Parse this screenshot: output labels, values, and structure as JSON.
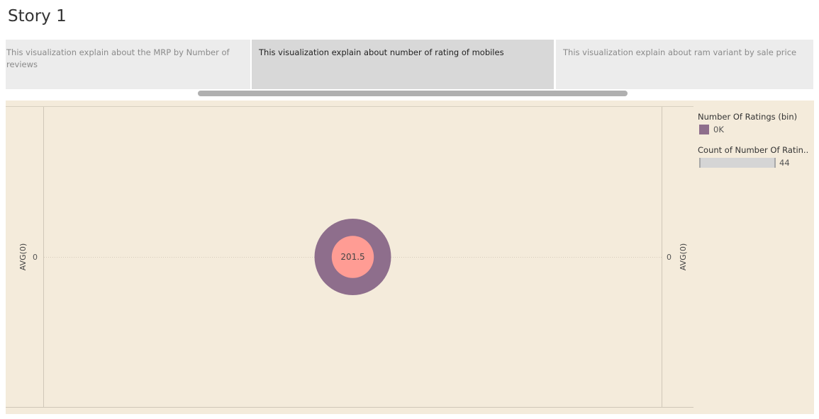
{
  "story": {
    "title": "Story 1"
  },
  "tabs": [
    {
      "label": "This visualization explain about the MRP by Number of reviews",
      "active": false
    },
    {
      "label": "This visualization explain about number of rating of mobiles",
      "active": true
    },
    {
      "label": "This visualization explain about ram variant by sale price",
      "active": false
    }
  ],
  "legend": {
    "color_title": "Number Of Ratings (bin)",
    "color_entries": [
      {
        "label": "0K",
        "color": "#8e6e8c"
      }
    ],
    "size_title": "Count of Number Of Ratin..",
    "size_max_label": "44"
  },
  "chart_data": {
    "type": "scatter",
    "title": "",
    "ylabel_left": "AVG(0)",
    "ylabel_right": "AVG(0)",
    "y_tick_left": "0",
    "y_tick_right": "0",
    "grid": false,
    "legend_position": "right",
    "points": [
      {
        "label": "201.5",
        "y": 0,
        "count": 44,
        "outer_color": "#8e6e8c",
        "inner_color": "#ff9c94"
      }
    ]
  }
}
